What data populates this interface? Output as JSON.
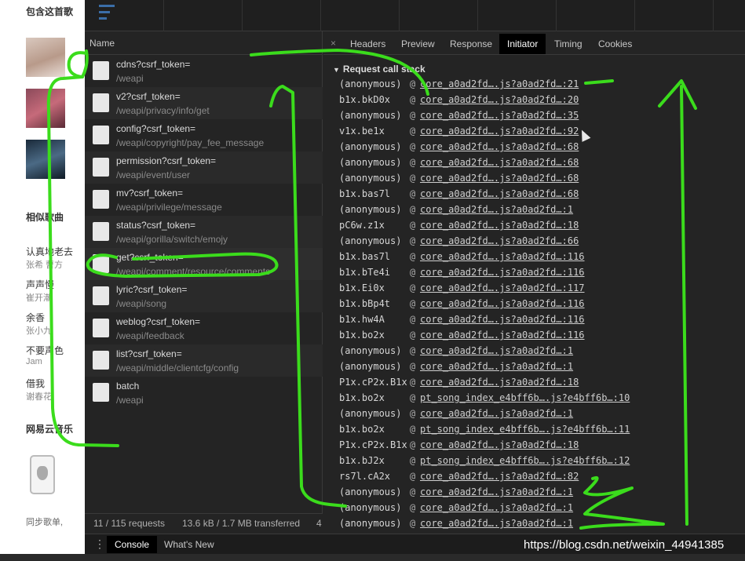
{
  "sidebar_page": {
    "heading_contains_song": "包含这首歌",
    "heading_similar_songs": "相似歌曲",
    "songs": [
      {
        "title": "认真地老去",
        "artist": "张希 曹方"
      },
      {
        "title": "声声慢",
        "artist": "崔开潮"
      },
      {
        "title": "余香",
        "artist": "张小九"
      },
      {
        "title": "不要声色",
        "artist": "Jam"
      },
      {
        "title": "借我",
        "artist": "谢春花"
      }
    ],
    "heading_netease": "网易云音乐",
    "bottom_text": "同步歌单,"
  },
  "network": {
    "column_name": "Name",
    "requests": [
      {
        "name": "cdns?csrf_token=",
        "path": "/weapi"
      },
      {
        "name": "v2?csrf_token=",
        "path": "/weapi/privacy/info/get"
      },
      {
        "name": "config?csrf_token=",
        "path": "/weapi/copyright/pay_fee_message"
      },
      {
        "name": "permission?csrf_token=",
        "path": "/weapi/event/user"
      },
      {
        "name": "mv?csrf_token=",
        "path": "/weapi/privilege/message"
      },
      {
        "name": "status?csrf_token=",
        "path": "/weapi/gorilla/switch/emojy"
      },
      {
        "name": "get?csrf_token=",
        "path": "/weapi/comment/resource/comments"
      },
      {
        "name": "lyric?csrf_token=",
        "path": "/weapi/song"
      },
      {
        "name": "weblog?csrf_token=",
        "path": "/weapi/feedback"
      },
      {
        "name": "list?csrf_token=",
        "path": "/weapi/middle/clientcfg/config"
      },
      {
        "name": "batch",
        "path": "/weapi"
      }
    ],
    "status": {
      "requests": "11 / 115 requests",
      "transferred": "13.6 kB / 1.7 MB transferred",
      "extra": "4"
    }
  },
  "detail": {
    "close_glyph": "×",
    "tabs": [
      "Headers",
      "Preview",
      "Response",
      "Initiator",
      "Timing",
      "Cookies"
    ],
    "active_tab": "Initiator",
    "section_toggle": "▼",
    "section_title": "Request call stack",
    "frames": [
      {
        "fn": "(anonymous)",
        "at": "@",
        "src": "core_a0ad2fd….js?a0ad2fd…:21"
      },
      {
        "fn": "b1x.bkD0x",
        "at": "@",
        "src": "core_a0ad2fd….js?a0ad2fd…:20"
      },
      {
        "fn": "(anonymous)",
        "at": "@",
        "src": "core_a0ad2fd….js?a0ad2fd…:35"
      },
      {
        "fn": "v1x.be1x",
        "at": "@",
        "src": "core_a0ad2fd….js?a0ad2fd…:92"
      },
      {
        "fn": "(anonymous)",
        "at": "@",
        "src": "core_a0ad2fd….js?a0ad2fd…:68"
      },
      {
        "fn": "(anonymous)",
        "at": "@",
        "src": "core_a0ad2fd….js?a0ad2fd…:68"
      },
      {
        "fn": "(anonymous)",
        "at": "@",
        "src": "core_a0ad2fd….js?a0ad2fd…:68"
      },
      {
        "fn": "b1x.bas7l",
        "at": "@",
        "src": "core_a0ad2fd….js?a0ad2fd…:68"
      },
      {
        "fn": "(anonymous)",
        "at": "@",
        "src": "core_a0ad2fd….js?a0ad2fd…:1"
      },
      {
        "fn": "pC6w.z1x",
        "at": "@",
        "src": "core_a0ad2fd….js?a0ad2fd…:18"
      },
      {
        "fn": "(anonymous)",
        "at": "@",
        "src": "core_a0ad2fd….js?a0ad2fd…:66"
      },
      {
        "fn": "b1x.bas7l",
        "at": "@",
        "src": "core_a0ad2fd….js?a0ad2fd…:116"
      },
      {
        "fn": "b1x.bTe4i",
        "at": "@",
        "src": "core_a0ad2fd….js?a0ad2fd…:116"
      },
      {
        "fn": "b1x.Ei0x",
        "at": "@",
        "src": "core_a0ad2fd….js?a0ad2fd…:117"
      },
      {
        "fn": "b1x.bBp4t",
        "at": "@",
        "src": "core_a0ad2fd….js?a0ad2fd…:116"
      },
      {
        "fn": "b1x.hw4A",
        "at": "@",
        "src": "core_a0ad2fd….js?a0ad2fd…:116"
      },
      {
        "fn": "b1x.bo2x",
        "at": "@",
        "src": "core_a0ad2fd….js?a0ad2fd…:116"
      },
      {
        "fn": "(anonymous)",
        "at": "@",
        "src": "core_a0ad2fd….js?a0ad2fd…:1"
      },
      {
        "fn": "(anonymous)",
        "at": "@",
        "src": "core_a0ad2fd….js?a0ad2fd…:1"
      },
      {
        "fn": "P1x.cP2x.B1x",
        "at": "@",
        "src": "core_a0ad2fd….js?a0ad2fd…:18"
      },
      {
        "fn": "b1x.bo2x",
        "at": "@",
        "src": "pt_song_index_e4bff6b….js?e4bff6b…:10"
      },
      {
        "fn": "(anonymous)",
        "at": "@",
        "src": "core_a0ad2fd….js?a0ad2fd…:1"
      },
      {
        "fn": "b1x.bo2x",
        "at": "@",
        "src": "pt_song_index_e4bff6b….js?e4bff6b…:11"
      },
      {
        "fn": "P1x.cP2x.B1x",
        "at": "@",
        "src": "core_a0ad2fd….js?a0ad2fd…:18"
      },
      {
        "fn": "b1x.bJ2x",
        "at": "@",
        "src": "pt_song_index_e4bff6b….js?e4bff6b…:12"
      },
      {
        "fn": "rs7l.cA2x",
        "at": "@",
        "src": "core_a0ad2fd….js?a0ad2fd…:82"
      },
      {
        "fn": "(anonymous)",
        "at": "@",
        "src": "core_a0ad2fd….js?a0ad2fd…:1"
      },
      {
        "fn": "(anonymous)",
        "at": "@",
        "src": "core_a0ad2fd….js?a0ad2fd…:1"
      },
      {
        "fn": "(anonymous)",
        "at": "@",
        "src": "core_a0ad2fd….js?a0ad2fd…:1"
      }
    ]
  },
  "drawer": {
    "menu_glyph": "⋮",
    "tabs": [
      "Console",
      "What's New"
    ],
    "active_tab": "Console"
  },
  "watermark": "https://blog.csdn.net/weixin_44941385",
  "colors": {
    "annotation": "#3bdc1c",
    "panel_bg": "#242424",
    "active_tab_bg": "#000000"
  }
}
